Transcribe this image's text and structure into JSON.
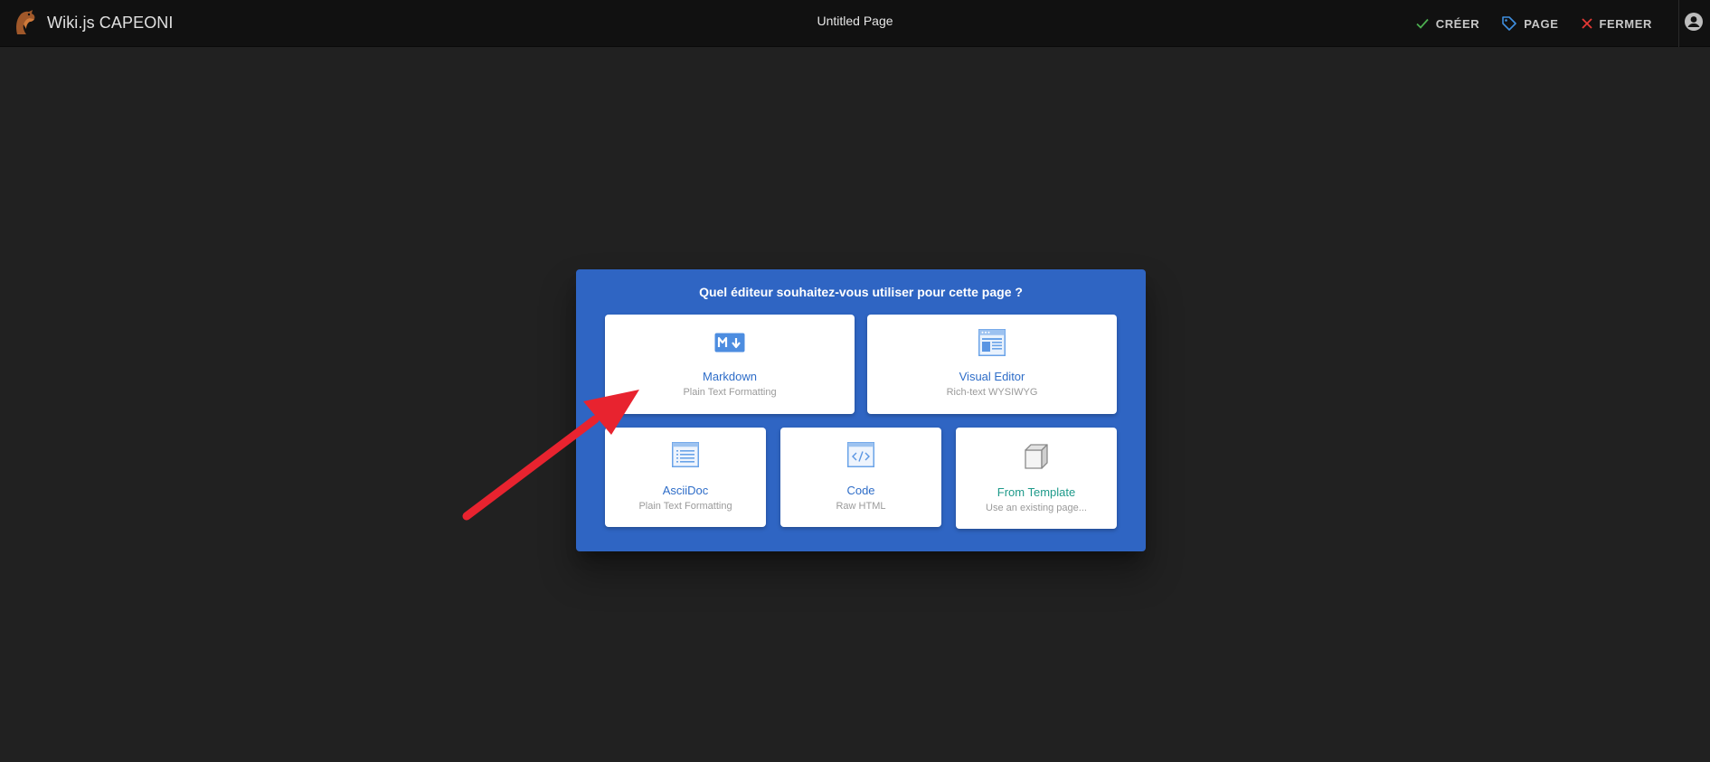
{
  "header": {
    "brand": "Wiki.js CAPEONI",
    "page_title": "Untitled Page",
    "actions": {
      "create": "CRÉER",
      "page": "PAGE",
      "close": "FERMER"
    }
  },
  "dialog": {
    "title": "Quel éditeur souhaitez-vous utiliser pour cette page ?",
    "editors": [
      {
        "label": "Markdown",
        "sub": "Plain Text Formatting",
        "icon": "markdown-icon"
      },
      {
        "label": "Visual Editor",
        "sub": "Rich-text WYSIWYG",
        "icon": "visual-editor-icon"
      },
      {
        "label": "AsciiDoc",
        "sub": "Plain Text Formatting",
        "icon": "asciidoc-icon"
      },
      {
        "label": "Code",
        "sub": "Raw HTML",
        "icon": "code-icon"
      },
      {
        "label": "From Template",
        "sub": "Use an existing page...",
        "icon": "template-cube-icon"
      }
    ]
  },
  "colors": {
    "dialog_bg": "#2f65c3",
    "editor_label": "#2e6dc8",
    "template_label": "#1e9a8a",
    "annotation_arrow": "#e8232f",
    "check": "#4caf50",
    "close_x": "#e53935",
    "tag": "#3f8fe0"
  }
}
